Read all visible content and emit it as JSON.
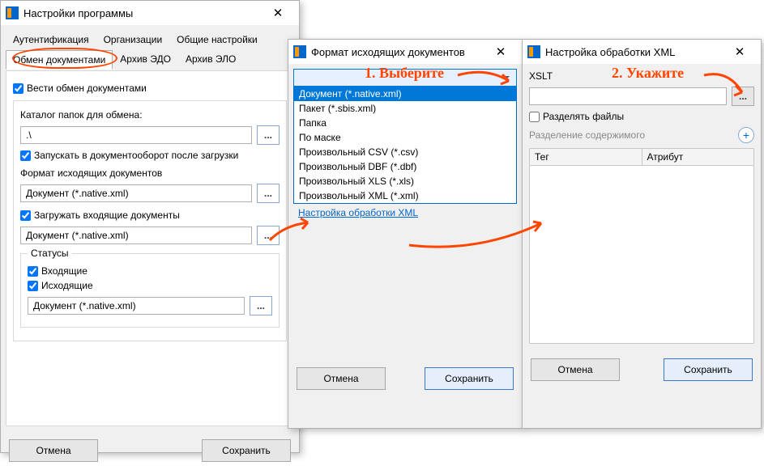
{
  "win1": {
    "title": "Настройки программы",
    "tabs_row1": [
      "Аутентификация",
      "Организации",
      "Общие настройки"
    ],
    "tabs_row2": [
      "Обмен документами",
      "Архив ЭДО",
      "Архив ЭЛО"
    ],
    "active_tab": "Обмен документами",
    "enable_exchange": "Вести обмен документами",
    "folder_label": "Каталог папок для обмена:",
    "folder_value": ".\\",
    "autostart": "Запускать в документооборот после загрузки",
    "out_format_label": "Формат исходящих документов",
    "out_format_value": "Документ (*.native.xml)",
    "load_incoming": "Загружать входящие документы",
    "incoming_value": "Документ (*.native.xml)",
    "statuses_label": "Статусы",
    "status_in": "Входящие",
    "status_out": "Исходящие",
    "status_value": "Документ (*.native.xml)",
    "cancel": "Отмена",
    "save": "Сохранить"
  },
  "win2": {
    "title": "Формат исходящих документов",
    "options": [
      "Документ (*.native.xml)",
      "Пакет (*.sbis.xml)",
      "Папка",
      "По маске",
      "Произвольный CSV (*.csv)",
      "Произвольный DBF (*.dbf)",
      "Произвольный XLS (*.xls)",
      "Произвольный XML (*.xml)"
    ],
    "selected_index": 0,
    "xml_link": "Настройка обработки XML",
    "cancel": "Отмена",
    "save": "Сохранить"
  },
  "win3": {
    "title": "Настройка обработки XML",
    "xslt_label": "XSLT",
    "xslt_value": "",
    "split_files": "Разделять файлы",
    "split_content": "Разделение содержимого",
    "col_tag": "Тег",
    "col_attr": "Атрибут",
    "cancel": "Отмена",
    "save": "Сохранить"
  },
  "anno": {
    "step1": "1. Выберите",
    "step2": "2. Укажите"
  }
}
